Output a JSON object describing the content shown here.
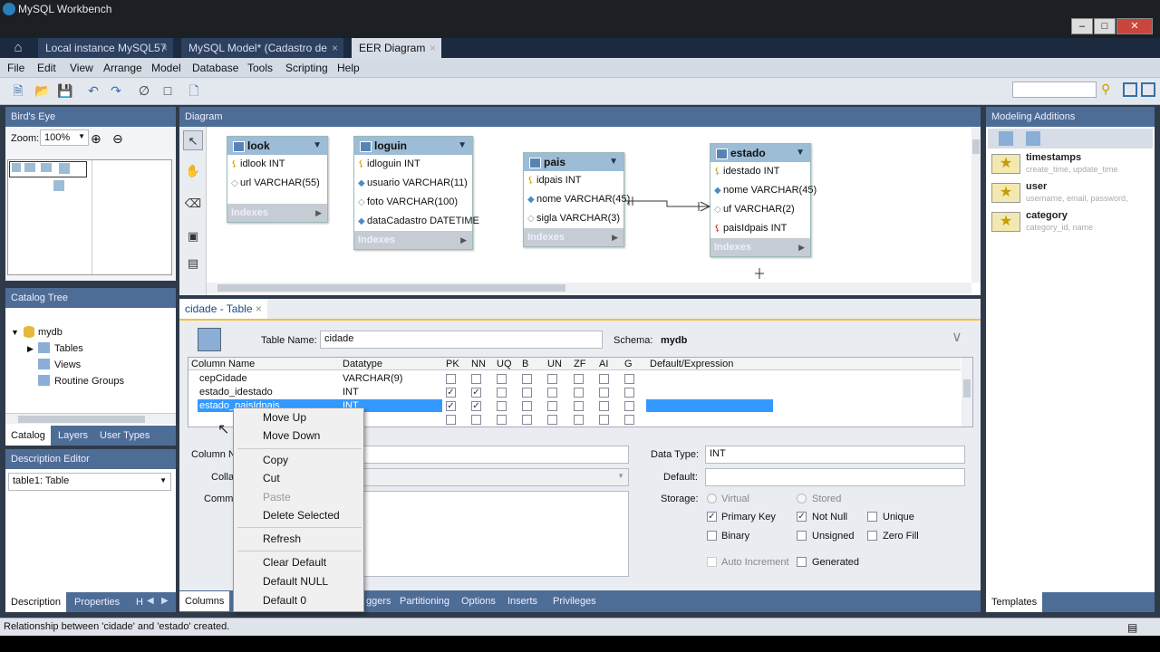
{
  "window": {
    "title": "MySQL Workbench"
  },
  "tabs": [
    {
      "label": "Local instance MySQL57",
      "active": false
    },
    {
      "label": "MySQL Model* (Cadastro de Client...",
      "active": false
    },
    {
      "label": "EER Diagram",
      "active": true
    }
  ],
  "menu": [
    "File",
    "Edit",
    "View",
    "Arrange",
    "Model",
    "Database",
    "Tools",
    "Scripting",
    "Help"
  ],
  "birds_eye": {
    "title": "Bird's Eye",
    "zoom_label": "Zoom:",
    "zoom_value": "100%"
  },
  "catalog_tree": {
    "title": "Catalog Tree",
    "root": "mydb",
    "items": [
      "Tables",
      "Views",
      "Routine Groups"
    ],
    "tabs": [
      "Catalog",
      "Layers",
      "User Types"
    ]
  },
  "description_editor": {
    "title": "Description Editor",
    "selected": "table1: Table",
    "tabs": [
      "Description",
      "Properties",
      "H"
    ]
  },
  "diagram": {
    "title": "Diagram",
    "tables": [
      {
        "name": "look",
        "rows": [
          "idlook INT",
          "url VARCHAR(55)"
        ],
        "indexes": "Indexes"
      },
      {
        "name": "loguin",
        "rows": [
          "idloguin INT",
          "usuario VARCHAR(11)",
          "foto VARCHAR(100)",
          "dataCadastro DATETIME"
        ],
        "indexes": "Indexes"
      },
      {
        "name": "pais",
        "rows": [
          "idpais INT",
          "nome VARCHAR(45)",
          "sigla VARCHAR(3)"
        ],
        "indexes": "Indexes"
      },
      {
        "name": "estado",
        "rows": [
          "idestado INT",
          "nome VARCHAR(45)",
          "uf VARCHAR(2)",
          "paisIdpais INT"
        ],
        "indexes": "Indexes"
      }
    ]
  },
  "editor": {
    "tab_label": "cidade - Table",
    "table_name_label": "Table Name:",
    "table_name": "cidade",
    "schema_label": "Schema:",
    "schema": "mydb",
    "columns_header": [
      "Column Name",
      "Datatype",
      "PK",
      "NN",
      "UQ",
      "B",
      "UN",
      "ZF",
      "AI",
      "G",
      "Default/Expression"
    ],
    "rows": [
      {
        "name": "cepCidade",
        "type": "VARCHAR(9)",
        "pk": false,
        "nn": false
      },
      {
        "name": "estado_idestado",
        "type": "INT",
        "pk": true,
        "nn": true
      },
      {
        "name": "estado_paisIdpais",
        "type": "INT",
        "pk": true,
        "nn": true
      }
    ],
    "details": {
      "column_name_label": "Column Na",
      "collation_label": "Colla",
      "comments_label": "Comme",
      "data_type_label": "Data Type:",
      "data_type": "INT",
      "default_label": "Default:",
      "storage_label": "Storage:",
      "virtual": "Virtual",
      "stored": "Stored",
      "primary_key": "Primary Key",
      "not_null": "Not Null",
      "unique": "Unique",
      "binary": "Binary",
      "unsigned": "Unsigned",
      "zero_fill": "Zero Fill",
      "auto_increment": "Auto Increment",
      "generated": "Generated"
    },
    "bottom_tabs": [
      "Columns",
      "ggers",
      "Partitioning",
      "Options",
      "Inserts",
      "Privileges"
    ]
  },
  "context_menu": {
    "items": [
      "Move Up",
      "Move Down",
      "Copy",
      "Cut",
      "Paste",
      "Delete Selected",
      "Refresh",
      "Clear Default",
      "Default NULL",
      "Default 0"
    ]
  },
  "modeling_additions": {
    "title": "Modeling Additions",
    "templates": [
      {
        "name": "timestamps",
        "desc": "create_time, update_time"
      },
      {
        "name": "user",
        "desc": "username, email, password,"
      },
      {
        "name": "category",
        "desc": "category_id, name"
      }
    ],
    "bottom_tab": "Templates"
  },
  "status": {
    "message": "Relationship between 'cidade' and 'estado' created."
  }
}
